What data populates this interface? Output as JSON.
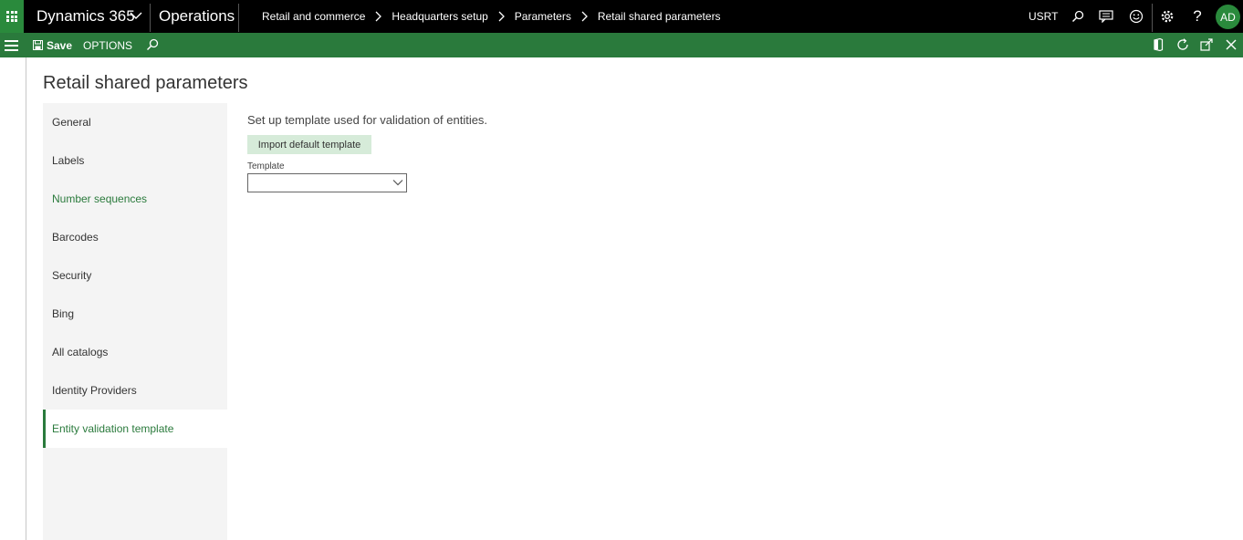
{
  "topbar": {
    "app_name": "Dynamics 365",
    "module": "Operations",
    "breadcrumb": [
      "Retail and commerce",
      "Headquarters setup",
      "Parameters",
      "Retail shared parameters"
    ],
    "company": "USRT",
    "user_initials": "AD",
    "help": "?"
  },
  "actionbar": {
    "save_label": "Save",
    "options_label": "OPTIONS"
  },
  "page": {
    "title": "Retail shared parameters"
  },
  "sidenav": {
    "items": [
      {
        "label": "General",
        "state": "normal"
      },
      {
        "label": "Labels",
        "state": "normal"
      },
      {
        "label": "Number sequences",
        "state": "visited"
      },
      {
        "label": "Barcodes",
        "state": "normal"
      },
      {
        "label": "Security",
        "state": "normal"
      },
      {
        "label": "Bing",
        "state": "normal"
      },
      {
        "label": "All catalogs",
        "state": "normal"
      },
      {
        "label": "Identity Providers",
        "state": "normal"
      },
      {
        "label": "Entity validation template",
        "state": "active"
      }
    ]
  },
  "content": {
    "description": "Set up template used for validation of entities.",
    "import_button_label": "Import default template",
    "template_label": "Template",
    "template_value": ""
  },
  "colors": {
    "brand_green": "#2a7a3c",
    "topbar_bg": "#000000",
    "button_bg": "#d6ebd9"
  },
  "icons": [
    "waffle-icon",
    "chevron-down-icon",
    "search-icon",
    "chat-icon",
    "smiley-icon",
    "gear-icon",
    "help-icon",
    "hamburger-icon",
    "save-icon",
    "office-icon",
    "refresh-icon",
    "popout-icon",
    "close-icon"
  ]
}
